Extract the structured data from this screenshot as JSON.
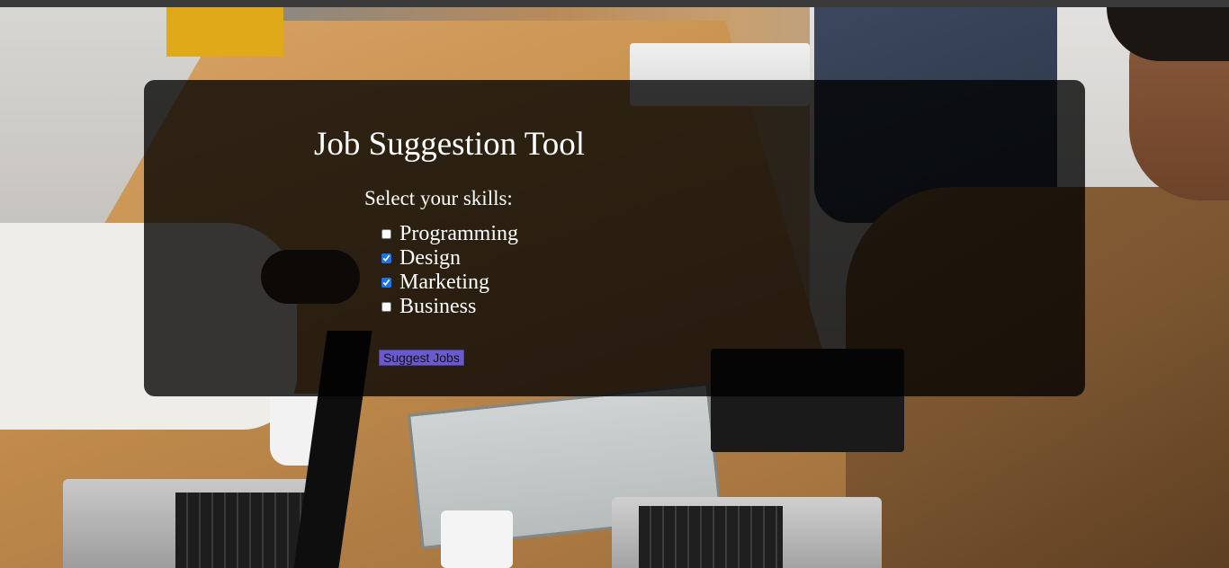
{
  "page": {
    "title": "Job Suggestion Tool"
  },
  "form": {
    "prompt": "Select your skills:",
    "skills": [
      {
        "label": "Programming",
        "checked": false
      },
      {
        "label": "Design",
        "checked": true
      },
      {
        "label": "Marketing",
        "checked": true
      },
      {
        "label": "Business",
        "checked": false
      }
    ],
    "submit_label": "Suggest Jobs"
  },
  "colors": {
    "overlay": "rgba(0,0,0,0.78)",
    "text": "#ffffff",
    "button_bg": "#6a5acd",
    "checkbox_accent": "#1a73e8"
  }
}
